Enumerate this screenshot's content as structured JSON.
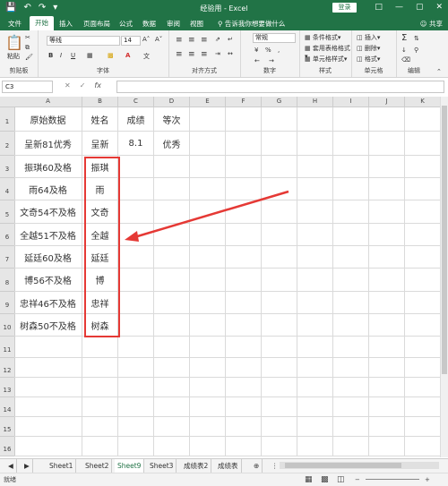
{
  "window": {
    "title": "经验用 - Excel",
    "login": "登录"
  },
  "tabs": {
    "items": [
      "文件",
      "开始",
      "插入",
      "页面布局",
      "公式",
      "数据",
      "审阅",
      "视图",
      "告诉我你想要做什么"
    ],
    "share": "共享"
  },
  "ribbon": {
    "clipboard_label": "剪贴板",
    "paste": "粘贴",
    "font_name": "等线",
    "font_size": "14",
    "font_label": "字体",
    "align_label": "对齐方式",
    "number_format": "常规",
    "number_label": "数字",
    "percent": "%",
    "styles": {
      "cond": "条件格式",
      "table": "套用表格格式",
      "cell": "单元格样式",
      "label": "样式"
    },
    "cells": {
      "insert": "插入",
      "delete": "删除",
      "format": "格式",
      "label": "单元格"
    },
    "edit_label": "编辑"
  },
  "formula_bar": {
    "name_box": "C3",
    "fx": "fx",
    "value": ""
  },
  "columns": [
    "A",
    "B",
    "C",
    "D",
    "E",
    "F",
    "G",
    "H",
    "I",
    "J",
    "K"
  ],
  "rows": [
    "1",
    "2",
    "3",
    "4",
    "5",
    "6",
    "7",
    "8",
    "9",
    "10",
    "11",
    "12",
    "13",
    "14",
    "15",
    "16"
  ],
  "cells": {
    "A": [
      "原始数据",
      "呈新81优秀",
      "振琪60及格",
      "雨64及格",
      "文奇54不及格",
      "全越51不及格",
      "延廷60及格",
      "博56不及格",
      "忠祥46不及格",
      "树森50不及格"
    ],
    "B": [
      "姓名",
      "呈新",
      "振琪",
      "雨",
      "文奇",
      "全越",
      "延廷",
      "博",
      "忠祥",
      "树森"
    ],
    "C": [
      "成绩",
      "8.1"
    ],
    "D": [
      "等次",
      "优秀"
    ]
  },
  "sheets": {
    "items": [
      "Sheet1",
      "Sheet2",
      "Sheet9",
      "Sheet3",
      "成绩表2",
      "成绩表"
    ],
    "active": "Sheet9"
  },
  "status": {
    "ready": "就绪"
  },
  "colors": {
    "brand": "#217346",
    "highlight": "#e53935"
  }
}
